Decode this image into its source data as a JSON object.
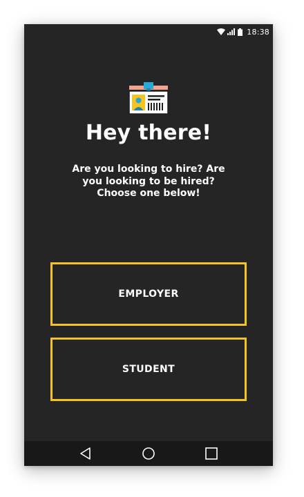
{
  "status_bar": {
    "time": "18:38",
    "icons": [
      "wifi-icon",
      "signal-icon",
      "battery-icon"
    ]
  },
  "header": {
    "icon": "id-badge-icon",
    "title": "Hey there!",
    "subtitle": "Are you looking to hire? Are you looking to be hired? Choose one below!"
  },
  "choices": {
    "employer_label": "EMPLOYER",
    "student_label": "STUDENT"
  },
  "nav_bar": {
    "icons": [
      "back-icon",
      "home-icon",
      "recents-icon"
    ]
  },
  "colors": {
    "background": "#252525",
    "accent": "#f6c321",
    "text": "#ffffff",
    "nav_background": "#181818"
  }
}
